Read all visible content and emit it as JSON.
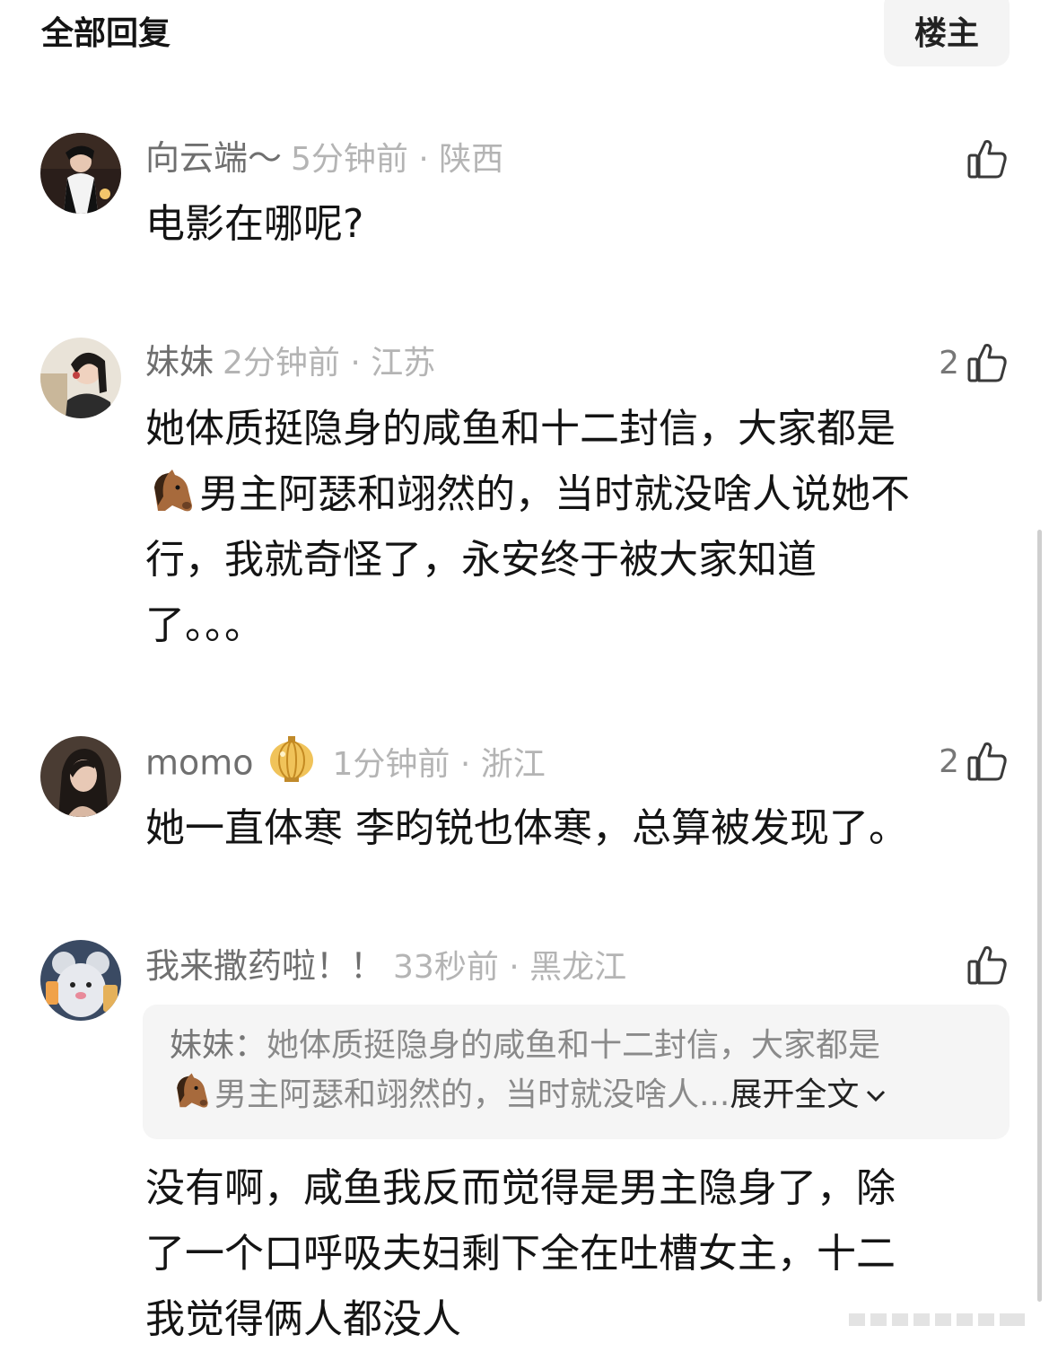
{
  "header": {
    "title": "全部回复",
    "owner_button": "楼主"
  },
  "comments": [
    {
      "author": "向云端～",
      "time_location": "5分钟前 · 陕西",
      "likes": "",
      "text": "电影在哪呢?"
    },
    {
      "author": "妹妹",
      "time_location": "2分钟前 · 江苏",
      "likes": "2",
      "text_line1": "她体质挺隐身的咸鱼和十二封信，大家都是",
      "text_line2": "男主阿瑟和翊然的，当时就没啥人说她不",
      "text_line3": "行，我就奇怪了，永安终于被大家知道",
      "text_line4": "了。。。"
    },
    {
      "author": "momo",
      "time_location": "1分钟前 · 浙江",
      "likes": "2",
      "text": "她一直体寒 李昀锐也体寒，总算被发现了。"
    },
    {
      "author": "我来撒药啦！！",
      "time_location": "33秒前 · 黑龙江",
      "likes": "",
      "quote_author": "妹妹：",
      "quote_line1": "她体质挺隐身的咸鱼和十二封信，大家都是",
      "quote_line2": "男主阿瑟和翊然的，当时就没啥人...",
      "quote_expand": "展开全文",
      "text_line1": "没有啊，咸鱼我反而觉得是男主隐身了，除",
      "text_line2": "了一个口呼吸夫妇剩下全在吐槽女主，十二",
      "text_line3": "我觉得俩人都没人"
    }
  ],
  "icons": {
    "like": "thumbs-up-icon",
    "horse": "horse-face-emoji",
    "lantern": "lantern-badge-icon",
    "expand": "chevron-down-icon"
  }
}
